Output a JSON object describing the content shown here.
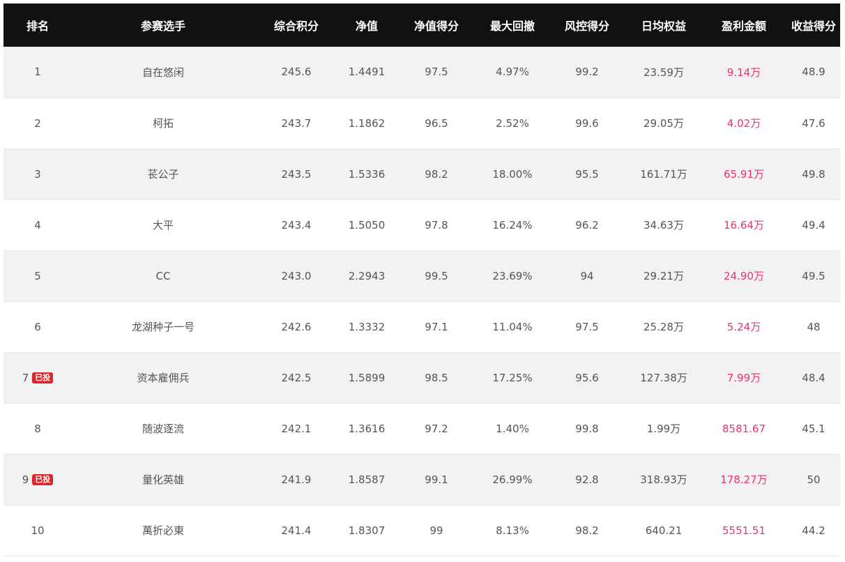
{
  "table": {
    "headers": [
      "排名",
      "参赛选手",
      "综合积分",
      "净值",
      "净值得分",
      "最大回撤",
      "风控得分",
      "日均权益",
      "盈利金额",
      "收益得分"
    ],
    "rows": [
      {
        "rank": "1",
        "badge": "",
        "name": "自在悠闲",
        "score": "245.6",
        "nav": "1.4491",
        "nav_score": "97.5",
        "max_drawdown": "4.97%",
        "risk_score": "99.2",
        "avg_equity": "23.59万",
        "profit": "9.14万",
        "return_score": "48.9"
      },
      {
        "rank": "2",
        "badge": "",
        "name": "柯拓",
        "score": "243.7",
        "nav": "1.1862",
        "nav_score": "96.5",
        "max_drawdown": "2.52%",
        "risk_score": "99.6",
        "avg_equity": "29.05万",
        "profit": "4.02万",
        "return_score": "47.6"
      },
      {
        "rank": "3",
        "badge": "",
        "name": "苌公子",
        "score": "243.5",
        "nav": "1.5336",
        "nav_score": "98.2",
        "max_drawdown": "18.00%",
        "risk_score": "95.5",
        "avg_equity": "161.71万",
        "profit": "65.91万",
        "return_score": "49.8"
      },
      {
        "rank": "4",
        "badge": "",
        "name": "大平",
        "score": "243.4",
        "nav": "1.5050",
        "nav_score": "97.8",
        "max_drawdown": "16.24%",
        "risk_score": "96.2",
        "avg_equity": "34.63万",
        "profit": "16.64万",
        "return_score": "49.4"
      },
      {
        "rank": "5",
        "badge": "",
        "name": "CC",
        "score": "243.0",
        "nav": "2.2943",
        "nav_score": "99.5",
        "max_drawdown": "23.69%",
        "risk_score": "94",
        "avg_equity": "29.21万",
        "profit": "24.90万",
        "return_score": "49.5"
      },
      {
        "rank": "6",
        "badge": "",
        "name": "龙湖种子一号",
        "score": "242.6",
        "nav": "1.3332",
        "nav_score": "97.1",
        "max_drawdown": "11.04%",
        "risk_score": "97.5",
        "avg_equity": "25.28万",
        "profit": "5.24万",
        "return_score": "48"
      },
      {
        "rank": "7",
        "badge": "已投",
        "name": "资本雇佣兵",
        "score": "242.5",
        "nav": "1.5899",
        "nav_score": "98.5",
        "max_drawdown": "17.25%",
        "risk_score": "95.6",
        "avg_equity": "127.38万",
        "profit": "7.99万",
        "return_score": "48.4"
      },
      {
        "rank": "8",
        "badge": "",
        "name": "随波逐流",
        "score": "242.1",
        "nav": "1.3616",
        "nav_score": "97.2",
        "max_drawdown": "1.40%",
        "risk_score": "99.8",
        "avg_equity": "1.99万",
        "profit": "8581.67",
        "return_score": "45.1"
      },
      {
        "rank": "9",
        "badge": "已投",
        "name": "量化英雄",
        "score": "241.9",
        "nav": "1.8587",
        "nav_score": "99.1",
        "max_drawdown": "26.99%",
        "risk_score": "92.8",
        "avg_equity": "318.93万",
        "profit": "178.27万",
        "return_score": "50"
      },
      {
        "rank": "10",
        "badge": "",
        "name": "萬折必東",
        "score": "241.4",
        "nav": "1.8307",
        "nav_score": "99",
        "max_drawdown": "8.13%",
        "risk_score": "98.2",
        "avg_equity": "640.21",
        "profit": "5551.51",
        "return_score": "44.2"
      }
    ]
  },
  "colors": {
    "header_bg": "#111111",
    "profit_text": "#e8336d",
    "badge_bg": "#d9262f",
    "row_alt_bg": "#f2f2f2"
  }
}
